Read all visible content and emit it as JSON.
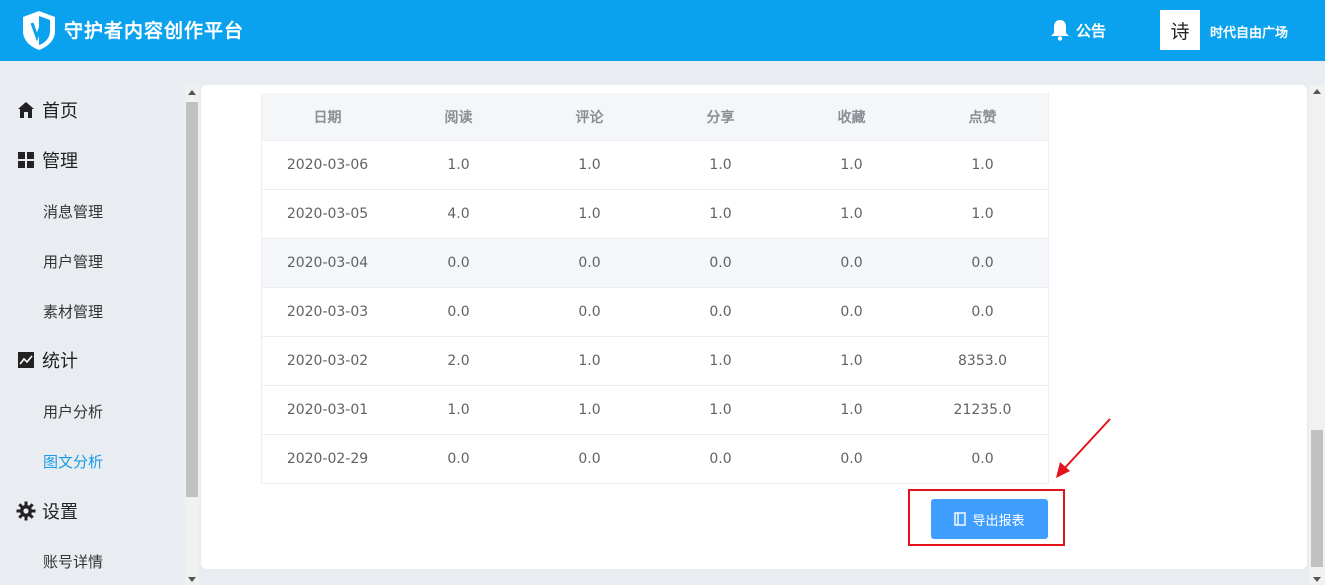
{
  "header": {
    "app_title": "守护者内容创作平台",
    "notice_label": "公告",
    "avatar_char": "诗",
    "user_name": "时代自由广场"
  },
  "sidebar": {
    "home": "首页",
    "manage": "管理",
    "manage_items": [
      "消息管理",
      "用户管理",
      "素材管理"
    ],
    "stats": "统计",
    "stats_items": [
      "用户分析",
      "图文分析"
    ],
    "settings": "设置",
    "settings_items": [
      "账号详情"
    ],
    "active_item": "图文分析"
  },
  "table": {
    "columns": [
      "日期",
      "阅读",
      "评论",
      "分享",
      "收藏",
      "点赞"
    ],
    "rows": [
      [
        "2020-03-06",
        "1.0",
        "1.0",
        "1.0",
        "1.0",
        "1.0"
      ],
      [
        "2020-03-05",
        "4.0",
        "1.0",
        "1.0",
        "1.0",
        "1.0"
      ],
      [
        "2020-03-04",
        "0.0",
        "0.0",
        "0.0",
        "0.0",
        "0.0"
      ],
      [
        "2020-03-03",
        "0.0",
        "0.0",
        "0.0",
        "0.0",
        "0.0"
      ],
      [
        "2020-03-02",
        "2.0",
        "1.0",
        "1.0",
        "1.0",
        "8353.0"
      ],
      [
        "2020-03-01",
        "1.0",
        "1.0",
        "1.0",
        "1.0",
        "21235.0"
      ],
      [
        "2020-02-29",
        "0.0",
        "0.0",
        "0.0",
        "0.0",
        "0.0"
      ]
    ]
  },
  "export_button": "导出报表",
  "colors": {
    "header_bg": "#0aa2ee",
    "active_nav": "#1a9ce8",
    "button_bg": "#409eff",
    "annotation_red": "#e3131c"
  },
  "icons": {
    "logo": "shield-logo-icon",
    "notice": "bell-icon",
    "home": "home-icon",
    "manage": "grid-icon",
    "stats": "chart-line-icon",
    "settings": "gear-icon",
    "export": "document-icon"
  }
}
